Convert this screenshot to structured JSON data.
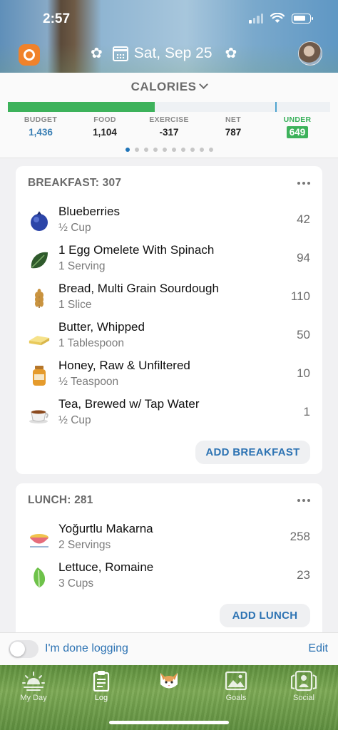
{
  "status": {
    "time": "2:57"
  },
  "header": {
    "date": "Sat, Sep 25"
  },
  "summary": {
    "title": "CALORIES",
    "progress_fraction": 0.455,
    "stats": [
      {
        "label": "BUDGET",
        "value": "1,436"
      },
      {
        "label": "FOOD",
        "value": "1,104"
      },
      {
        "label": "EXERCISE",
        "value": "-317"
      },
      {
        "label": "NET",
        "value": "787"
      },
      {
        "label": "UNDER",
        "value": "649"
      }
    ],
    "pager": {
      "count": 10,
      "active": 0
    }
  },
  "breakfast": {
    "title": "BREAKFAST: 307",
    "items": [
      {
        "name": "Blueberries",
        "serving": "½ Cup",
        "calories": "42",
        "icon": "blueberry-icon"
      },
      {
        "name": "1 Egg Omelete With Spinach",
        "serving": "1 Serving",
        "calories": "94",
        "icon": "spinach-icon"
      },
      {
        "name": "Bread, Multi Grain Sourdough",
        "serving": "1 Slice",
        "calories": "110",
        "icon": "wheat-icon"
      },
      {
        "name": "Butter, Whipped",
        "serving": "1 Tablespoon",
        "calories": "50",
        "icon": "butter-icon"
      },
      {
        "name": "Honey, Raw & Unfiltered",
        "serving": "½ Teaspoon",
        "calories": "10",
        "icon": "honey-jar-icon"
      },
      {
        "name": "Tea, Brewed w/ Tap Water",
        "serving": "½ Cup",
        "calories": "1",
        "icon": "tea-cup-icon"
      }
    ],
    "add_label": "ADD BREAKFAST"
  },
  "lunch": {
    "title": "LUNCH: 281",
    "items": [
      {
        "name": "Yoğurtlu Makarna",
        "serving": "2 Servings",
        "calories": "258",
        "icon": "pasta-bowl-icon"
      },
      {
        "name": "Lettuce, Romaine",
        "serving": "3 Cups",
        "calories": "23",
        "icon": "lettuce-icon"
      }
    ],
    "add_label": "ADD LUNCH"
  },
  "done_bar": {
    "label": "I'm done logging",
    "edit": "Edit",
    "done": false
  },
  "tabs": [
    {
      "label": "My Day",
      "icon": "sunrise-icon"
    },
    {
      "label": "Log",
      "icon": "clipboard-icon"
    },
    {
      "label": "",
      "icon": "cat-mascot-icon"
    },
    {
      "label": "Goals",
      "icon": "mountain-image-icon"
    },
    {
      "label": "Social",
      "icon": "people-icon"
    }
  ],
  "colors": {
    "accent_blue": "#2d73b3",
    "green": "#3db25b",
    "logo_orange": "#f0822b"
  }
}
